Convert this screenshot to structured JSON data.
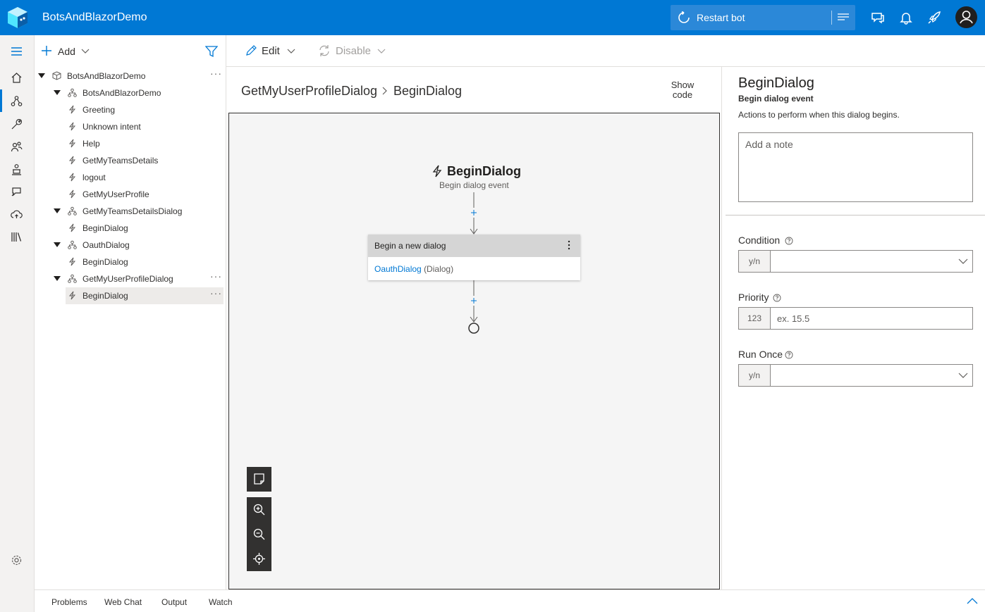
{
  "app": {
    "title": "BotsAndBlazorDemo"
  },
  "header": {
    "restart_label": "Restart bot",
    "accent": "#0078d4"
  },
  "nav": {
    "items": [
      "home-icon",
      "design-icon",
      "configure-icon",
      "users-icon",
      "bot-responses-icon",
      "language-icon",
      "publish-icon",
      "library-icon"
    ],
    "settings": "settings-icon"
  },
  "tree_toolbar": {
    "add_label": "Add"
  },
  "tree": [
    {
      "label": "BotsAndBlazorDemo",
      "type": "bot",
      "level": 0,
      "expanded": true,
      "more": true
    },
    {
      "label": "BotsAndBlazorDemo",
      "type": "dialog",
      "level": 1,
      "expanded": true
    },
    {
      "label": "Greeting",
      "type": "trigger",
      "level": 2
    },
    {
      "label": "Unknown intent",
      "type": "trigger",
      "level": 2
    },
    {
      "label": "Help",
      "type": "trigger",
      "level": 2
    },
    {
      "label": "GetMyTeamsDetails",
      "type": "trigger",
      "level": 2
    },
    {
      "label": "logout",
      "type": "trigger",
      "level": 2
    },
    {
      "label": "GetMyUserProfile",
      "type": "trigger",
      "level": 2
    },
    {
      "label": "GetMyTeamsDetailsDialog",
      "type": "dialog",
      "level": 1,
      "expanded": true
    },
    {
      "label": "BeginDialog",
      "type": "trigger",
      "level": 2
    },
    {
      "label": "OauthDialog",
      "type": "dialog",
      "level": 1,
      "expanded": true
    },
    {
      "label": "BeginDialog",
      "type": "trigger",
      "level": 2
    },
    {
      "label": "GetMyUserProfileDialog",
      "type": "dialog",
      "level": 1,
      "expanded": true,
      "more": true
    },
    {
      "label": "BeginDialog",
      "type": "trigger",
      "level": 2,
      "selected": true,
      "more": true
    }
  ],
  "toolbar": {
    "edit_label": "Edit",
    "disable_label": "Disable"
  },
  "breadcrumb": {
    "dialog": "GetMyUserProfileDialog",
    "trigger": "BeginDialog"
  },
  "show_code_line1": "Show",
  "show_code_line2": "code",
  "canvas": {
    "trigger_title": "BeginDialog",
    "trigger_subtitle": "Begin dialog event",
    "action": {
      "header": "Begin a new dialog",
      "dialog_link": "OauthDialog",
      "dialog_type": "(Dialog)"
    }
  },
  "properties": {
    "title": "BeginDialog",
    "subtitle": "Begin dialog event",
    "description": "Actions to perform when this dialog begins.",
    "note_placeholder": "Add a note",
    "condition_label": "Condition",
    "condition_prefix": "y/n",
    "priority_label": "Priority",
    "priority_prefix": "123",
    "priority_placeholder": "ex. 15.5",
    "run_once_label": "Run Once",
    "run_once_prefix": "y/n"
  },
  "bottom_tabs": [
    "Problems",
    "Web Chat",
    "Output",
    "Watch"
  ]
}
